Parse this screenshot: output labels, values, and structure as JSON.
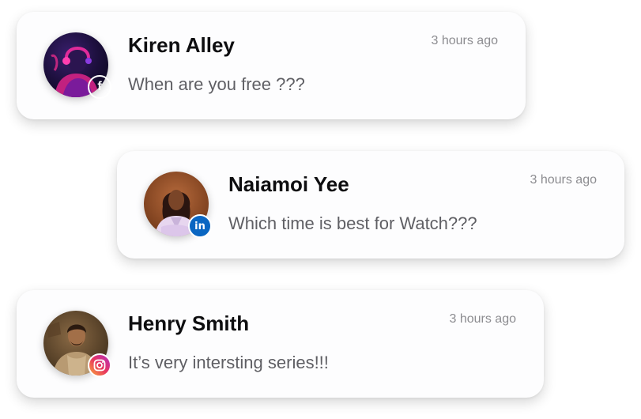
{
  "messages": [
    {
      "name": "Kiren Alley",
      "time": "3 hours ago",
      "text": "When are you free ???",
      "platform": "facebook",
      "platform_icon": "facebook-icon",
      "platform_color": "#1877f2",
      "badge_glyph": "f"
    },
    {
      "name": "Naiamoi Yee",
      "time": "3 hours ago",
      "text": "Which time is best for Watch???",
      "platform": "linkedin",
      "platform_icon": "linkedin-icon",
      "platform_color": "#0a66c2",
      "badge_glyph": "in"
    },
    {
      "name": "Henry Smith",
      "time": "3 hours ago",
      "text": "It’s very intersting series!!!",
      "platform": "instagram",
      "platform_icon": "instagram-icon",
      "platform_color": "#e8355f",
      "badge_glyph": ""
    }
  ]
}
